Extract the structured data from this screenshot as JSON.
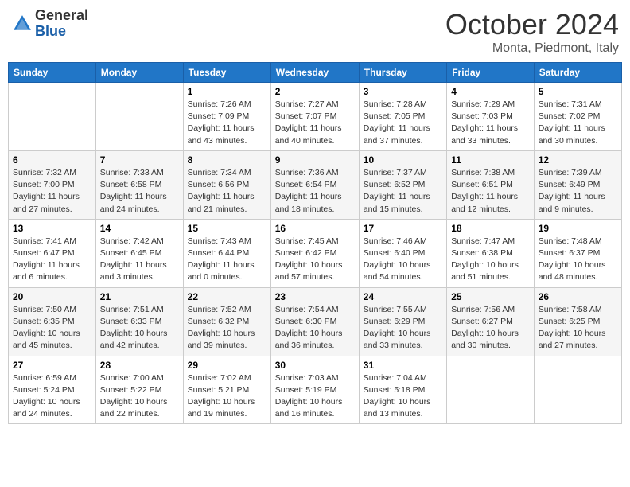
{
  "header": {
    "logo_general": "General",
    "logo_blue": "Blue",
    "month": "October 2024",
    "location": "Monta, Piedmont, Italy"
  },
  "weekdays": [
    "Sunday",
    "Monday",
    "Tuesday",
    "Wednesday",
    "Thursday",
    "Friday",
    "Saturday"
  ],
  "weeks": [
    [
      {
        "day": "",
        "sunrise": "",
        "sunset": "",
        "daylight": ""
      },
      {
        "day": "",
        "sunrise": "",
        "sunset": "",
        "daylight": ""
      },
      {
        "day": "1",
        "sunrise": "Sunrise: 7:26 AM",
        "sunset": "Sunset: 7:09 PM",
        "daylight": "Daylight: 11 hours and 43 minutes."
      },
      {
        "day": "2",
        "sunrise": "Sunrise: 7:27 AM",
        "sunset": "Sunset: 7:07 PM",
        "daylight": "Daylight: 11 hours and 40 minutes."
      },
      {
        "day": "3",
        "sunrise": "Sunrise: 7:28 AM",
        "sunset": "Sunset: 7:05 PM",
        "daylight": "Daylight: 11 hours and 37 minutes."
      },
      {
        "day": "4",
        "sunrise": "Sunrise: 7:29 AM",
        "sunset": "Sunset: 7:03 PM",
        "daylight": "Daylight: 11 hours and 33 minutes."
      },
      {
        "day": "5",
        "sunrise": "Sunrise: 7:31 AM",
        "sunset": "Sunset: 7:02 PM",
        "daylight": "Daylight: 11 hours and 30 minutes."
      }
    ],
    [
      {
        "day": "6",
        "sunrise": "Sunrise: 7:32 AM",
        "sunset": "Sunset: 7:00 PM",
        "daylight": "Daylight: 11 hours and 27 minutes."
      },
      {
        "day": "7",
        "sunrise": "Sunrise: 7:33 AM",
        "sunset": "Sunset: 6:58 PM",
        "daylight": "Daylight: 11 hours and 24 minutes."
      },
      {
        "day": "8",
        "sunrise": "Sunrise: 7:34 AM",
        "sunset": "Sunset: 6:56 PM",
        "daylight": "Daylight: 11 hours and 21 minutes."
      },
      {
        "day": "9",
        "sunrise": "Sunrise: 7:36 AM",
        "sunset": "Sunset: 6:54 PM",
        "daylight": "Daylight: 11 hours and 18 minutes."
      },
      {
        "day": "10",
        "sunrise": "Sunrise: 7:37 AM",
        "sunset": "Sunset: 6:52 PM",
        "daylight": "Daylight: 11 hours and 15 minutes."
      },
      {
        "day": "11",
        "sunrise": "Sunrise: 7:38 AM",
        "sunset": "Sunset: 6:51 PM",
        "daylight": "Daylight: 11 hours and 12 minutes."
      },
      {
        "day": "12",
        "sunrise": "Sunrise: 7:39 AM",
        "sunset": "Sunset: 6:49 PM",
        "daylight": "Daylight: 11 hours and 9 minutes."
      }
    ],
    [
      {
        "day": "13",
        "sunrise": "Sunrise: 7:41 AM",
        "sunset": "Sunset: 6:47 PM",
        "daylight": "Daylight: 11 hours and 6 minutes."
      },
      {
        "day": "14",
        "sunrise": "Sunrise: 7:42 AM",
        "sunset": "Sunset: 6:45 PM",
        "daylight": "Daylight: 11 hours and 3 minutes."
      },
      {
        "day": "15",
        "sunrise": "Sunrise: 7:43 AM",
        "sunset": "Sunset: 6:44 PM",
        "daylight": "Daylight: 11 hours and 0 minutes."
      },
      {
        "day": "16",
        "sunrise": "Sunrise: 7:45 AM",
        "sunset": "Sunset: 6:42 PM",
        "daylight": "Daylight: 10 hours and 57 minutes."
      },
      {
        "day": "17",
        "sunrise": "Sunrise: 7:46 AM",
        "sunset": "Sunset: 6:40 PM",
        "daylight": "Daylight: 10 hours and 54 minutes."
      },
      {
        "day": "18",
        "sunrise": "Sunrise: 7:47 AM",
        "sunset": "Sunset: 6:38 PM",
        "daylight": "Daylight: 10 hours and 51 minutes."
      },
      {
        "day": "19",
        "sunrise": "Sunrise: 7:48 AM",
        "sunset": "Sunset: 6:37 PM",
        "daylight": "Daylight: 10 hours and 48 minutes."
      }
    ],
    [
      {
        "day": "20",
        "sunrise": "Sunrise: 7:50 AM",
        "sunset": "Sunset: 6:35 PM",
        "daylight": "Daylight: 10 hours and 45 minutes."
      },
      {
        "day": "21",
        "sunrise": "Sunrise: 7:51 AM",
        "sunset": "Sunset: 6:33 PM",
        "daylight": "Daylight: 10 hours and 42 minutes."
      },
      {
        "day": "22",
        "sunrise": "Sunrise: 7:52 AM",
        "sunset": "Sunset: 6:32 PM",
        "daylight": "Daylight: 10 hours and 39 minutes."
      },
      {
        "day": "23",
        "sunrise": "Sunrise: 7:54 AM",
        "sunset": "Sunset: 6:30 PM",
        "daylight": "Daylight: 10 hours and 36 minutes."
      },
      {
        "day": "24",
        "sunrise": "Sunrise: 7:55 AM",
        "sunset": "Sunset: 6:29 PM",
        "daylight": "Daylight: 10 hours and 33 minutes."
      },
      {
        "day": "25",
        "sunrise": "Sunrise: 7:56 AM",
        "sunset": "Sunset: 6:27 PM",
        "daylight": "Daylight: 10 hours and 30 minutes."
      },
      {
        "day": "26",
        "sunrise": "Sunrise: 7:58 AM",
        "sunset": "Sunset: 6:25 PM",
        "daylight": "Daylight: 10 hours and 27 minutes."
      }
    ],
    [
      {
        "day": "27",
        "sunrise": "Sunrise: 6:59 AM",
        "sunset": "Sunset: 5:24 PM",
        "daylight": "Daylight: 10 hours and 24 minutes."
      },
      {
        "day": "28",
        "sunrise": "Sunrise: 7:00 AM",
        "sunset": "Sunset: 5:22 PM",
        "daylight": "Daylight: 10 hours and 22 minutes."
      },
      {
        "day": "29",
        "sunrise": "Sunrise: 7:02 AM",
        "sunset": "Sunset: 5:21 PM",
        "daylight": "Daylight: 10 hours and 19 minutes."
      },
      {
        "day": "30",
        "sunrise": "Sunrise: 7:03 AM",
        "sunset": "Sunset: 5:19 PM",
        "daylight": "Daylight: 10 hours and 16 minutes."
      },
      {
        "day": "31",
        "sunrise": "Sunrise: 7:04 AM",
        "sunset": "Sunset: 5:18 PM",
        "daylight": "Daylight: 10 hours and 13 minutes."
      },
      {
        "day": "",
        "sunrise": "",
        "sunset": "",
        "daylight": ""
      },
      {
        "day": "",
        "sunrise": "",
        "sunset": "",
        "daylight": ""
      }
    ]
  ]
}
